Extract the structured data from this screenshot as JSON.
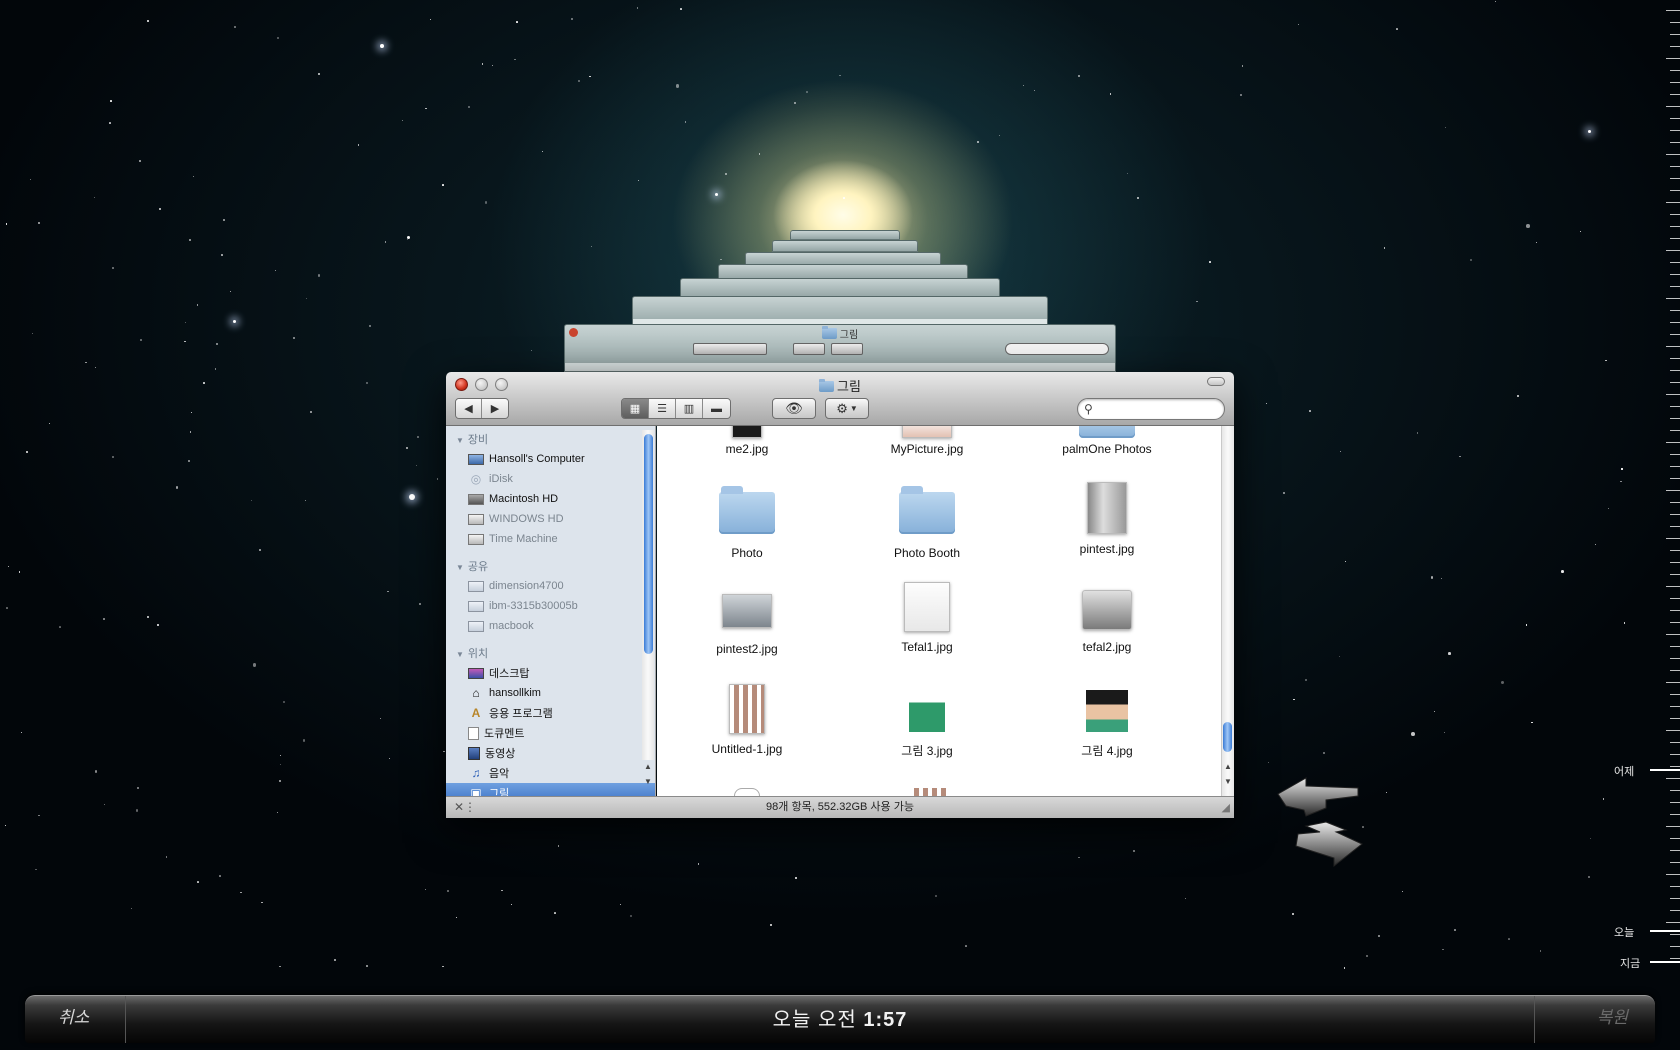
{
  "finder": {
    "title": "그림",
    "search_placeholder": "",
    "status": "98개 항목, 552.32GB 사용 가능",
    "sidebar": {
      "sections": [
        {
          "label": "장비",
          "items": [
            {
              "label": "Hansoll's Computer",
              "icon": "computer-icon",
              "dim": false
            },
            {
              "label": "iDisk",
              "icon": "idisk-icon",
              "dim": true
            },
            {
              "label": "Macintosh HD",
              "icon": "hard-drive-icon",
              "dim": false
            },
            {
              "label": "WINDOWS HD",
              "icon": "hard-drive-icon",
              "dim": true
            },
            {
              "label": "Time Machine",
              "icon": "time-machine-icon",
              "dim": true
            }
          ]
        },
        {
          "label": "공유",
          "items": [
            {
              "label": "dimension4700",
              "icon": "network-computer-icon",
              "dim": true
            },
            {
              "label": "ibm-3315b30005b",
              "icon": "network-computer-icon",
              "dim": true
            },
            {
              "label": "macbook",
              "icon": "network-computer-icon",
              "dim": true
            }
          ]
        },
        {
          "label": "위치",
          "items": [
            {
              "label": "데스크탑",
              "icon": "desktop-icon",
              "dim": false
            },
            {
              "label": "hansollkim",
              "icon": "home-icon",
              "dim": false
            },
            {
              "label": "응용 프로그램",
              "icon": "applications-icon",
              "dim": false
            },
            {
              "label": "도큐멘트",
              "icon": "documents-icon",
              "dim": false
            },
            {
              "label": "동영상",
              "icon": "movies-icon",
              "dim": false
            },
            {
              "label": "음악",
              "icon": "music-icon",
              "dim": false
            },
            {
              "label": "그림",
              "icon": "pictures-icon",
              "dim": false,
              "selected": true
            }
          ]
        }
      ]
    },
    "files": [
      {
        "name": "me2.jpg",
        "kind": "image"
      },
      {
        "name": "MyPicture.jpg",
        "kind": "image"
      },
      {
        "name": "palmOne Photos",
        "kind": "folder"
      },
      {
        "name": "Photo",
        "kind": "folder"
      },
      {
        "name": "Photo Booth",
        "kind": "folder"
      },
      {
        "name": "pintest.jpg",
        "kind": "image"
      },
      {
        "name": "pintest2.jpg",
        "kind": "image"
      },
      {
        "name": "Tefal1.jpg",
        "kind": "image"
      },
      {
        "name": "tefal2.jpg",
        "kind": "image"
      },
      {
        "name": "Untitled-1.jpg",
        "kind": "image"
      },
      {
        "name": "그림 3.jpg",
        "kind": "image"
      },
      {
        "name": "그림 4.jpg",
        "kind": "image"
      }
    ],
    "ghost_title": "그림"
  },
  "timeline": {
    "yesterday": "어제",
    "today": "오늘",
    "now": "지금"
  },
  "bottom_bar": {
    "cancel": "취소",
    "restore": "복원",
    "time_prefix": "오늘 오전",
    "time_value": "1:57"
  },
  "colors": {
    "selection": "#3e74c6",
    "scroll_blue": "#3a7bd5",
    "sidebar_bg": "#dde4ec"
  }
}
